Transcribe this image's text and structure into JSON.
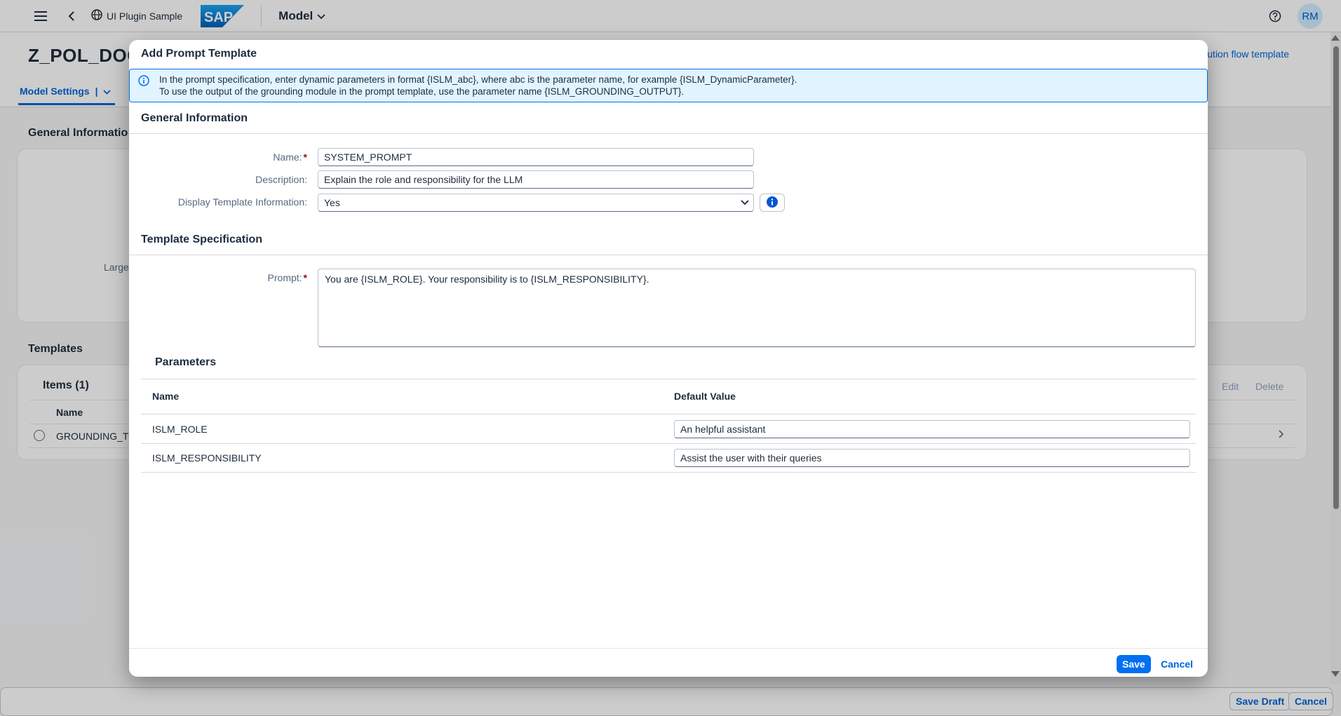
{
  "shell": {
    "app_title": "UI Plugin Sample",
    "logo_text": "SAP",
    "menu_label": "Model",
    "avatar_initials": "RM"
  },
  "page": {
    "object_title": "Z_POL_DOC",
    "header_link": "ution flow template",
    "anchor_tab": "Model Settings",
    "sections": {
      "general": "General Informatio",
      "templates": "Templates"
    },
    "large_label": "Large",
    "items_title": "Items (1)",
    "col_name": "Name",
    "row_value": "GROUNDING_TE",
    "edit_label": "Edit",
    "delete_label": "Delete",
    "footer": {
      "save_draft": "Save Draft",
      "cancel": "Cancel"
    }
  },
  "dialog": {
    "title": "Add Prompt Template",
    "info_line1": "In the prompt specification, enter dynamic parameters in format {ISLM_abc}, where abc is the parameter name, for example {ISLM_DynamicParameter}.",
    "info_line2": "To use the output of the grounding module in the prompt template, use the parameter name {ISLM_GROUNDING_OUTPUT}.",
    "general_section": "General Information",
    "name_label": "Name:",
    "name_value": "SYSTEM_PROMPT",
    "description_label": "Description:",
    "description_value": "Explain the role and responsibility for the LLM",
    "display_label": "Display Template Information:",
    "display_value": "Yes",
    "template_section": "Template Specification",
    "prompt_label": "Prompt:",
    "prompt_value": "You are {ISLM_ROLE}. Your responsibility is to {ISLM_RESPONSIBILITY}.",
    "parameters": {
      "title": "Parameters",
      "col_name": "Name",
      "col_default": "Default Value",
      "rows": [
        {
          "name": "ISLM_ROLE",
          "value": "An helpful assistant"
        },
        {
          "name": "ISLM_RESPONSIBILITY",
          "value": "Assist the user with their queries"
        }
      ]
    },
    "save_label": "Save",
    "cancel_label": "Cancel"
  },
  "colors": {
    "brand_blue": "#0070f2",
    "link_blue": "#0064d9",
    "info_bg": "#e1f4ff",
    "required_red": "#aa0808"
  },
  "icons": [
    "menu-icon",
    "back-icon",
    "globe-icon",
    "chevron-down-icon",
    "help-icon",
    "info-icon",
    "chevron-right-icon"
  ]
}
